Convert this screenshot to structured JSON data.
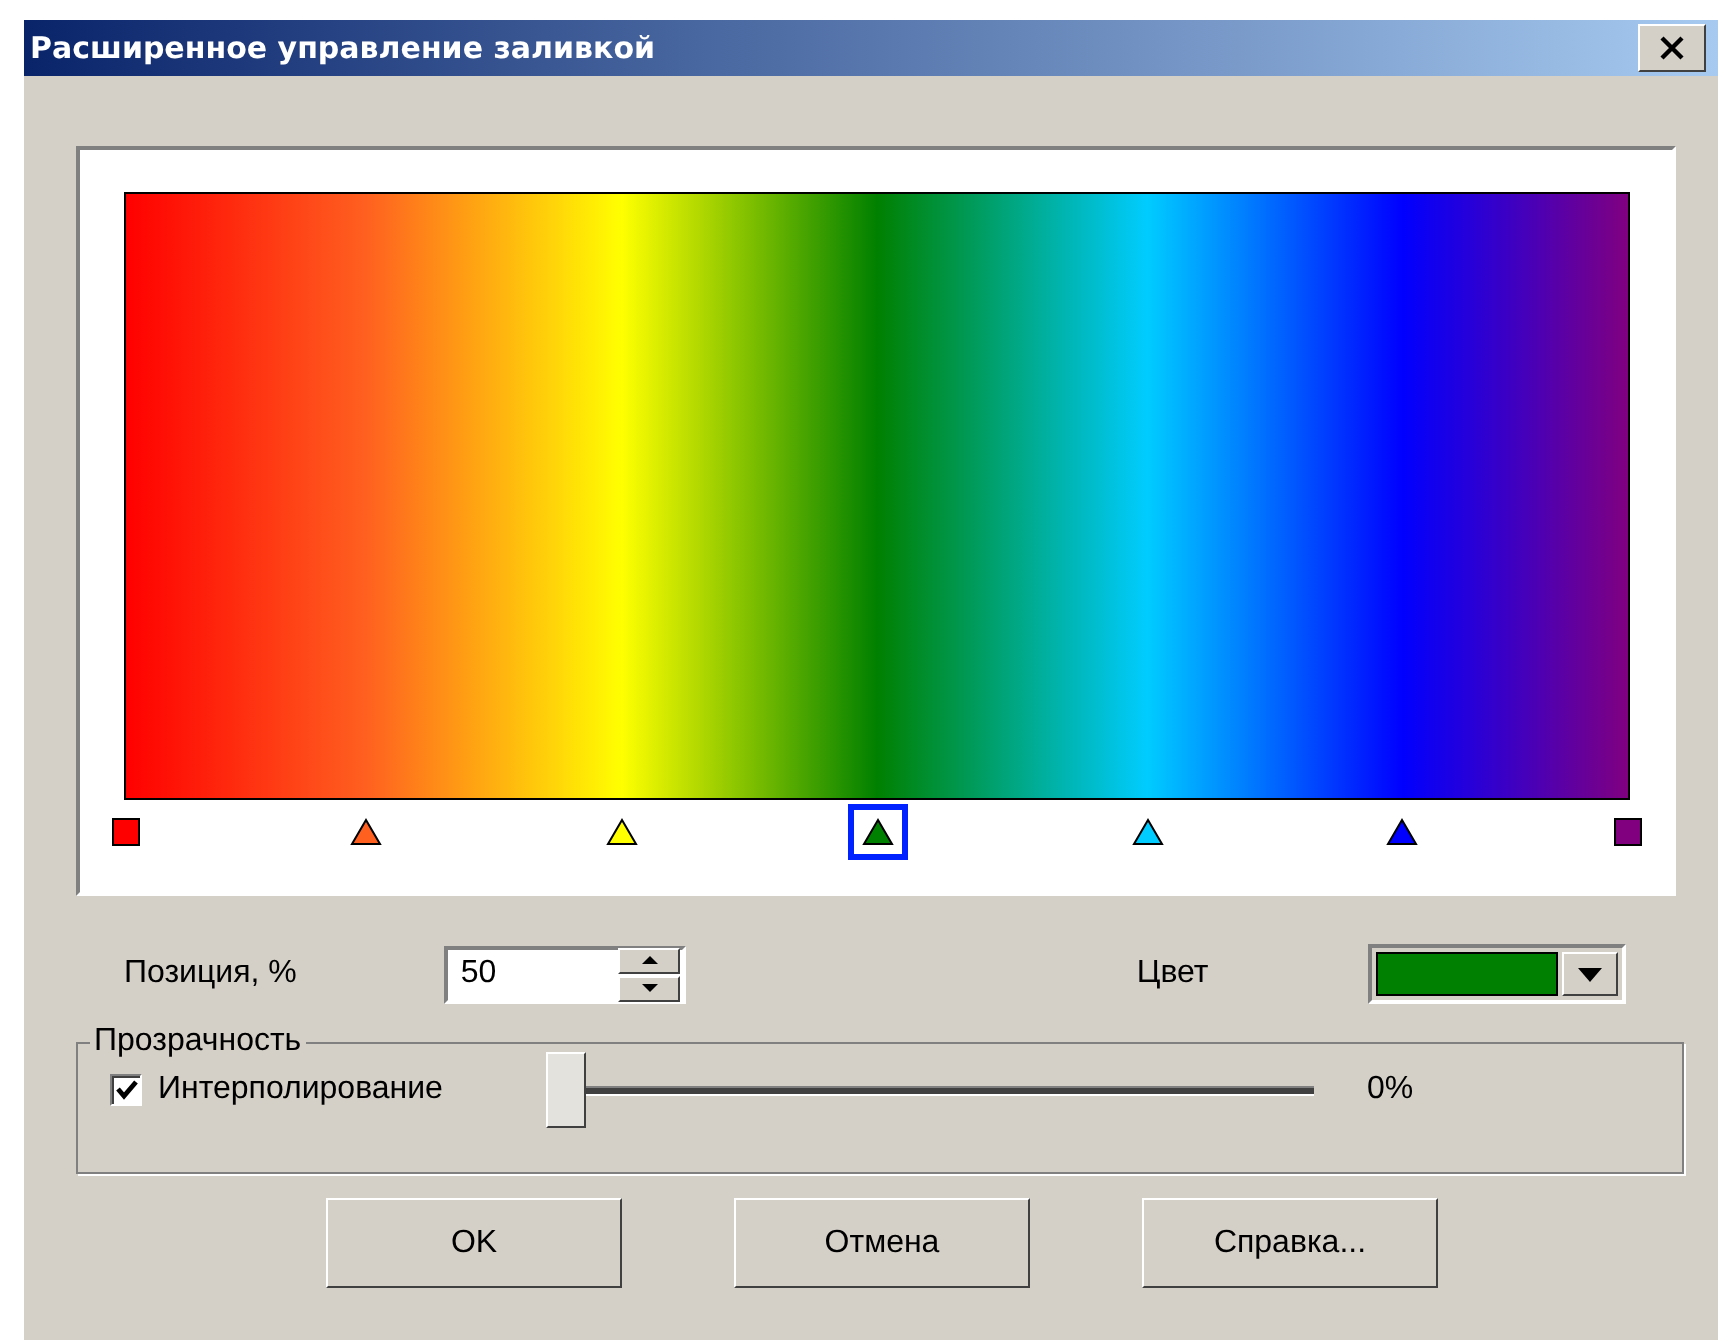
{
  "window": {
    "title": "Расширенное управление заливкой"
  },
  "gradient_stops": [
    {
      "kind": "end",
      "level": 0,
      "color": "#ff0000",
      "selected": false
    },
    {
      "kind": "stop",
      "level": 0.16,
      "color": "#ff6020",
      "selected": false
    },
    {
      "kind": "stop",
      "level": 0.33,
      "color": "#ffff00",
      "selected": false
    },
    {
      "kind": "stop",
      "level": 0.5,
      "color": "#008000",
      "selected": true
    },
    {
      "kind": "stop",
      "level": 0.68,
      "color": "#00ccff",
      "selected": false
    },
    {
      "kind": "stop",
      "level": 0.85,
      "color": "#0000ff",
      "selected": false
    },
    {
      "kind": "end",
      "level": 1,
      "color": "#800080",
      "selected": false
    }
  ],
  "position": {
    "label": "Позиция, %",
    "value": "50"
  },
  "color_picker": {
    "label": "Цвет"
  },
  "transparency": {
    "legend": "Прозрачность",
    "interpolation": {
      "label": "Интерполирование",
      "checked": true
    },
    "slider": {
      "level": 0
    },
    "reading": "0%"
  },
  "buttons": [
    "OK",
    "Отмена",
    "Справка..."
  ]
}
